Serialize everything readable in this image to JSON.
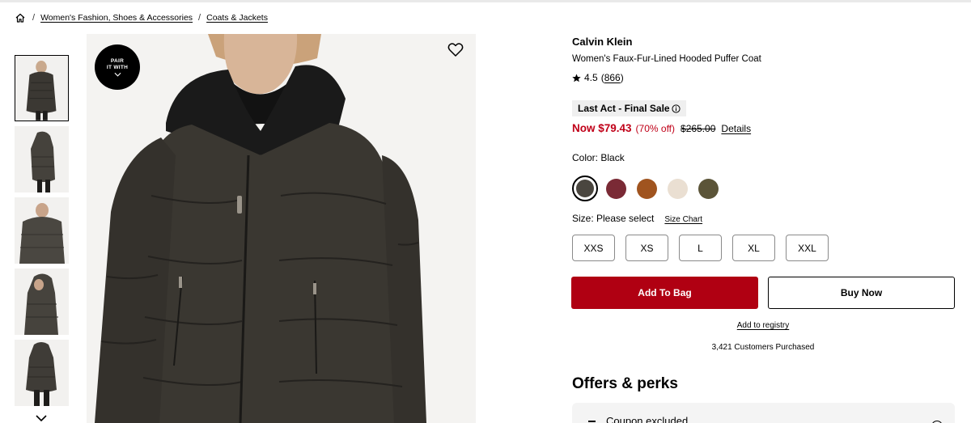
{
  "breadcrumb": {
    "home_icon": "home-icon",
    "items": [
      "Women's Fashion, Shoes & Accessories",
      "Coats & Jackets"
    ]
  },
  "gallery": {
    "badge_line1": "PAIR",
    "badge_line2": "IT WITH",
    "thumbnail_count_visible": 5,
    "selected_thumbnail": 1
  },
  "product": {
    "brand": "Calvin Klein",
    "title": "Women's Faux-Fur-Lined Hooded Puffer Coat",
    "rating": "4.5",
    "review_count": "(866)",
    "review_count_number": "866",
    "sale_badge": "Last Act - Final Sale",
    "price_now": "Now $79.43",
    "price_pct": "(70% off)",
    "price_original": "$265.00",
    "details_link": "Details",
    "color_label": "Color: Black",
    "colors": [
      {
        "name": "Black",
        "hex": "#4a463f",
        "selected": true
      },
      {
        "name": "Burgundy",
        "hex": "#7a2a35",
        "selected": false
      },
      {
        "name": "Cognac",
        "hex": "#a0541f",
        "selected": false
      },
      {
        "name": "Cream",
        "hex": "#eadfd2",
        "selected": false
      },
      {
        "name": "Olive",
        "hex": "#5b5438",
        "selected": false
      }
    ],
    "size_label": "Size: Please select",
    "size_chart": "Size Chart",
    "sizes": [
      "XXS",
      "XS",
      "L",
      "XL",
      "XXL"
    ],
    "add_to_bag": "Add To Bag",
    "buy_now": "Buy Now",
    "add_to_registry": "Add to registry",
    "customers_purchased": "3,421 Customers Purchased"
  },
  "offers": {
    "title": "Offers & perks",
    "coupon_label": "Coupon excluded"
  },
  "colors": {
    "sale_red": "#c00018",
    "button_red": "#b00012"
  }
}
